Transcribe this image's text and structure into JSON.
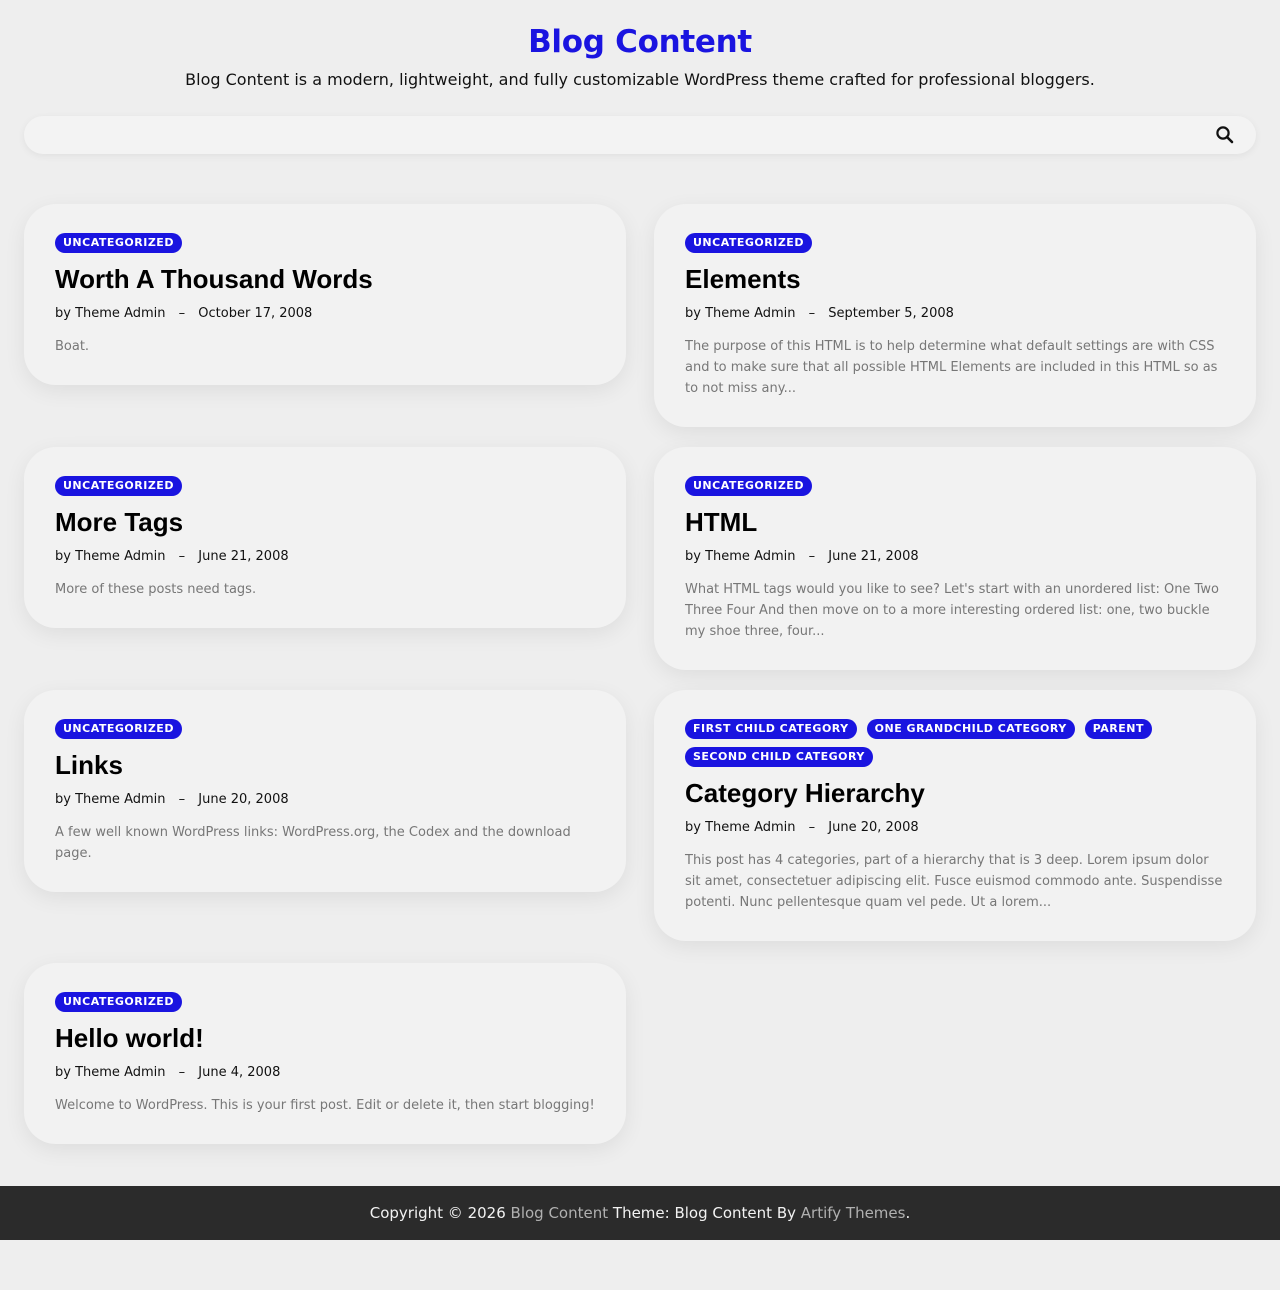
{
  "site": {
    "title": "Blog Content",
    "description": "Blog Content is a modern, lightweight, and fully customizable WordPress theme crafted for professional bloggers."
  },
  "search": {
    "placeholder": "",
    "value": "",
    "icon": "search-icon"
  },
  "colors": {
    "accent": "#1a14e0",
    "background": "#eeeeee",
    "card": "#f2f2f2",
    "footer": "#2b2b2b"
  },
  "posts": [
    {
      "categories": [
        "UNCATEGORIZED"
      ],
      "title": "Worth A Thousand Words",
      "by": "by",
      "author": "Theme Admin",
      "separator": "–",
      "date": "October 17, 2008",
      "excerpt": "Boat."
    },
    {
      "categories": [
        "UNCATEGORIZED"
      ],
      "title": "Elements",
      "by": "by",
      "author": "Theme Admin",
      "separator": "–",
      "date": "September 5, 2008",
      "excerpt": "The purpose of this HTML is to help determine what default settings are with CSS and to make sure that all possible HTML Elements are included in this HTML so as to not miss any..."
    },
    {
      "categories": [
        "UNCATEGORIZED"
      ],
      "title": "More Tags",
      "by": "by",
      "author": "Theme Admin",
      "separator": "–",
      "date": "June 21, 2008",
      "excerpt": "More of these posts need tags."
    },
    {
      "categories": [
        "UNCATEGORIZED"
      ],
      "title": "HTML",
      "by": "by",
      "author": "Theme Admin",
      "separator": "–",
      "date": "June 21, 2008",
      "excerpt": "What HTML tags would you like to see? Let's start with an unordered list: One Two Three Four And then move on to a more interesting ordered list: one, two buckle my shoe three, four..."
    },
    {
      "categories": [
        "UNCATEGORIZED"
      ],
      "title": "Links",
      "by": "by",
      "author": "Theme Admin",
      "separator": "–",
      "date": "June 20, 2008",
      "excerpt": "A few well known WordPress links: WordPress.org, the Codex and the download page."
    },
    {
      "categories": [
        "FIRST CHILD CATEGORY",
        "ONE GRANDCHILD CATEGORY",
        "PARENT",
        "SECOND CHILD CATEGORY"
      ],
      "title": "Category Hierarchy",
      "by": "by",
      "author": "Theme Admin",
      "separator": "–",
      "date": "June 20, 2008",
      "excerpt": "This post has 4 categories, part of a hierarchy that is 3 deep. Lorem ipsum dolor sit amet, consectetuer adipiscing elit. Fusce euismod commodo ante. Suspendisse potenti. Nunc pellentesque quam vel pede. Ut a lorem..."
    },
    {
      "categories": [
        "UNCATEGORIZED"
      ],
      "title": "Hello world!",
      "by": "by",
      "author": "Theme Admin",
      "separator": "–",
      "date": "June 4, 2008",
      "excerpt": "Welcome to WordPress. This is your first post. Edit or delete it, then start blogging!"
    }
  ],
  "footer": {
    "copyright": "Copyright © 2026",
    "site_link": "Blog Content",
    "theme_text": "Theme: Blog Content By",
    "author_link": "Artify Themes",
    "period": "."
  }
}
